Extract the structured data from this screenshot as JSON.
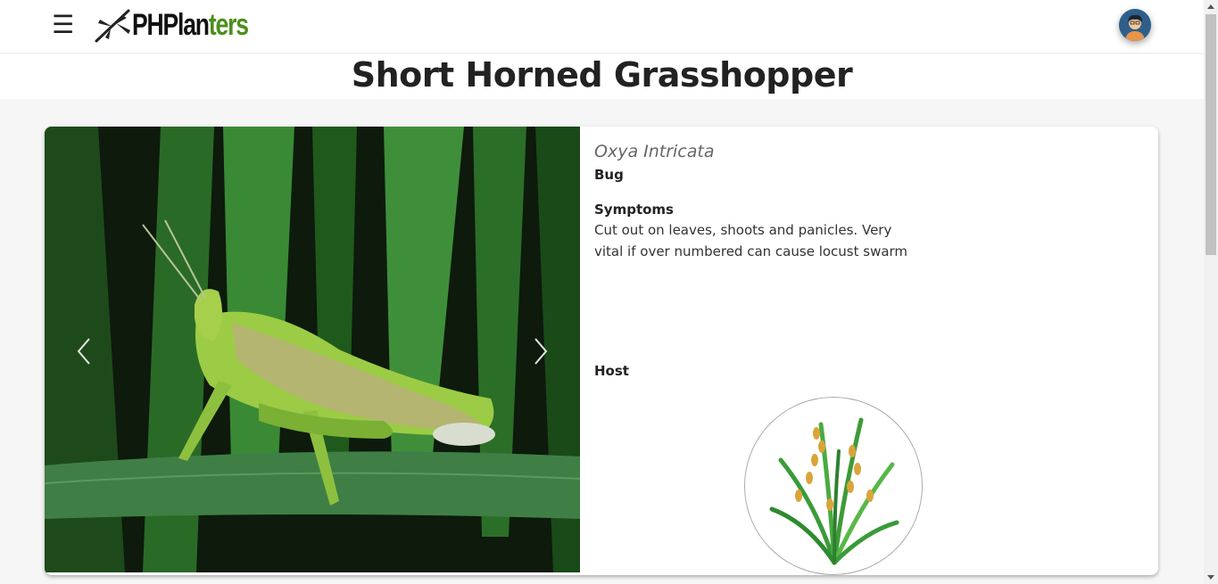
{
  "header": {
    "menu_icon": "hamburger-icon",
    "logo_text_dark": "PHPlan",
    "logo_text_green": "ters",
    "logo_icon": "dragonfly-icon",
    "avatar_icon": "user-avatar-icon"
  },
  "page": {
    "title": "Short Horned Grasshopper"
  },
  "pest": {
    "scientific_name": "Oxya Intricata",
    "category": "Bug",
    "symptoms_heading": "Symptoms",
    "symptoms_text": "Cut out on leaves, shoots and panicles. Very vital if over numbered can cause locust swarm",
    "host_heading": "Host"
  },
  "carousel": {
    "prev_icon": "chevron-left-icon",
    "next_icon": "chevron-right-icon"
  },
  "colors": {
    "brand_green": "#4c8f1c",
    "text_dark": "#222222"
  }
}
